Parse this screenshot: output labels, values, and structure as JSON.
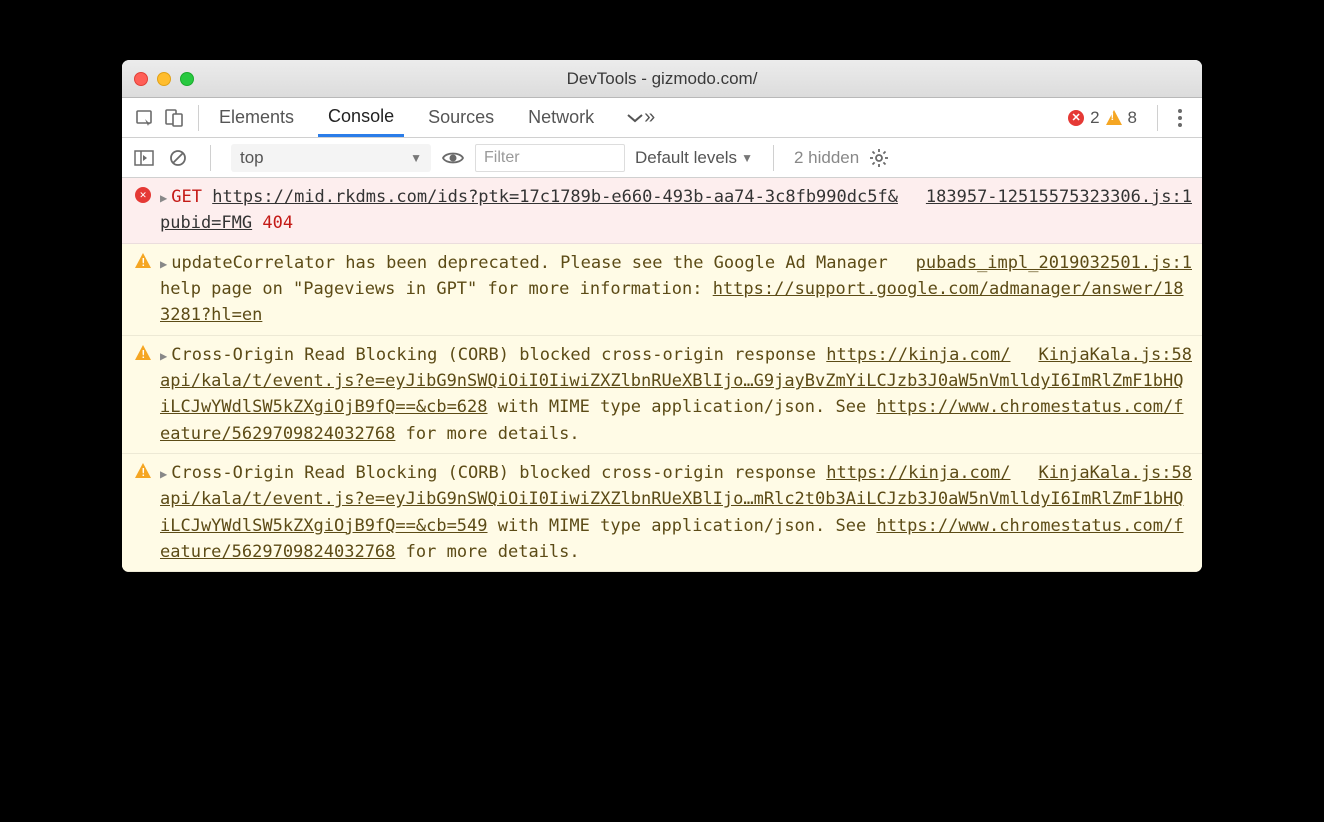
{
  "window": {
    "title": "DevTools - gizmodo.com/"
  },
  "toolbar": {
    "tabs": [
      "Elements",
      "Console",
      "Sources",
      "Network"
    ],
    "active_tab": "Console",
    "error_count": "2",
    "warning_count": "8"
  },
  "filterbar": {
    "context": "top",
    "filter_placeholder": "Filter",
    "levels_label": "Default levels",
    "hidden_label": "2 hidden"
  },
  "messages": [
    {
      "type": "error",
      "method": "GET",
      "url": "https://mid.rkdms.com/ids?ptk=17c1789b-e660-493b-aa74-3c8fb990dc5f&pubid=FMG",
      "status": "404",
      "source": "183957-12515575323306.js:1"
    },
    {
      "type": "warning",
      "text_prefix": "updateCorrelator has been deprecated. Please see the Google Ad Manager help page on \"Pageviews in GPT\" for more information: ",
      "link": "https://support.google.com/admanager/answer/183281?hl=en",
      "source": "pubads_impl_2019032501.js:1"
    },
    {
      "type": "warning",
      "text_prefix": "Cross-Origin Read Blocking (CORB) blocked cross-origin response ",
      "url": "https://kinja.com/api/kala/t/event.js?e=eyJibG9nSWQiOiI0IiwiZXZlbnRUeXBlIjo…G9jayBvZmYiLCJzb3J0aW5nVmlldyI6ImRlZmF1bHQiLCJwYWdlSW5kZXgiOjB9fQ==&cb=628",
      "text_middle": " with MIME type application/json. See ",
      "link": "https://www.chromestatus.com/feature/5629709824032768",
      "text_suffix": " for more details.",
      "source": "KinjaKala.js:58"
    },
    {
      "type": "warning",
      "text_prefix": "Cross-Origin Read Blocking (CORB) blocked cross-origin response ",
      "url": "https://kinja.com/api/kala/t/event.js?e=eyJibG9nSWQiOiI0IiwiZXZlbnRUeXBlIjo…mRlc2t0b3AiLCJzb3J0aW5nVmlldyI6ImRlZmF1bHQiLCJwYWdlSW5kZXgiOjB9fQ==&cb=549",
      "text_middle": " with MIME type application/json. See ",
      "link": "https://www.chromestatus.com/feature/5629709824032768",
      "text_suffix": " for more details.",
      "source": "KinjaKala.js:58"
    }
  ]
}
